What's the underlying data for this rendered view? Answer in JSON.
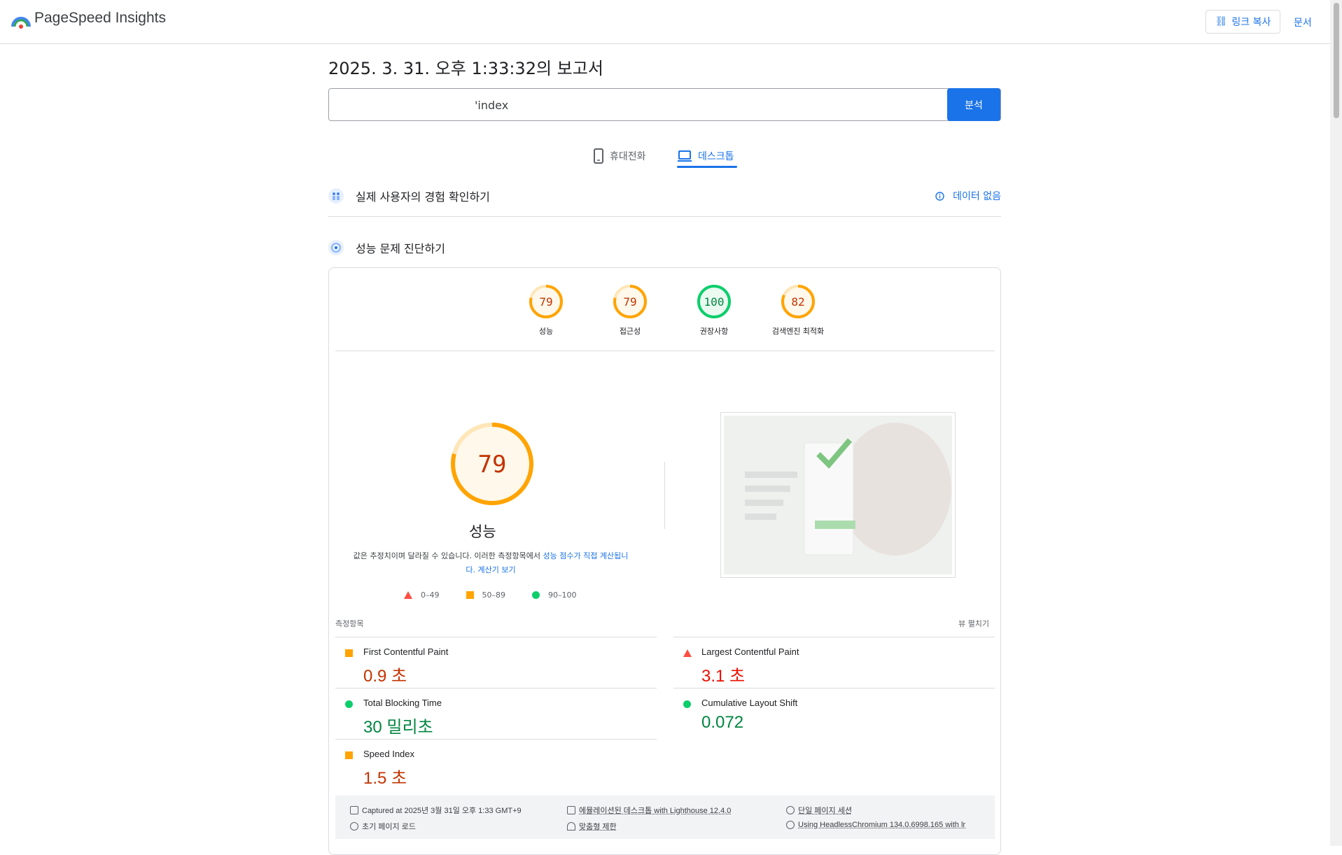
{
  "app": {
    "name": "PageSpeed Insights"
  },
  "header": {
    "copy_link_label": "링크 복사",
    "docs_label": "문서"
  },
  "report": {
    "title": "2025. 3. 31. 오후 1:33:32의 보고서",
    "url_value": "'index",
    "analyze_label": "분석"
  },
  "tabs": [
    {
      "label": "휴대전화",
      "active": false
    },
    {
      "label": "데스크톱",
      "active": true
    }
  ],
  "sections": {
    "real_users": {
      "title": "실제 사용자의 경험 확인하기",
      "status": "데이터 없음"
    },
    "diagnose": {
      "title": "성능 문제 진단하기"
    }
  },
  "scores": [
    {
      "label": "성능",
      "value": "79",
      "color": "#ffa400"
    },
    {
      "label": "접근성",
      "value": "79",
      "color": "#ffa400"
    },
    {
      "label": "권장사항",
      "value": "100",
      "color": "#0cce6b"
    },
    {
      "label": "검색엔진 최적화",
      "value": "82",
      "color": "#ffa400"
    }
  ],
  "performance": {
    "score": "79",
    "label": "성능",
    "note_plain": "값은 추정치이며 달라질 수 있습니다. 이러한 측정항목에서 ",
    "note_link": "성능 점수가 직접 계산됩니다.",
    "calc_link": "계산기 보기"
  },
  "legend": [
    {
      "range": "0–49",
      "shape": "triangle",
      "color": "#ff4e42"
    },
    {
      "range": "50–89",
      "shape": "square",
      "color": "#ffa400"
    },
    {
      "range": "90–100",
      "shape": "circle",
      "color": "#0cce6b"
    }
  ],
  "metrics": {
    "header": "측정항목",
    "expand": "뷰 펼치기",
    "items": [
      {
        "name": "First Contentful Paint",
        "value": "0.9 초",
        "status": "average",
        "color": "#c33300",
        "marker": "#ffa400"
      },
      {
        "name": "Largest Contentful Paint",
        "value": "3.1 초",
        "status": "fail",
        "color": "#eb0f00",
        "marker": "#ff4e42"
      },
      {
        "name": "Total Blocking Time",
        "value": "30 밀리초",
        "status": "pass",
        "color": "#018642",
        "marker": "#0cce6b"
      },
      {
        "name": "Cumulative Layout Shift",
        "value": "0.072",
        "status": "pass",
        "color": "#018642",
        "marker": "#0cce6b"
      },
      {
        "name": "Speed Index",
        "value": "1.5 초",
        "status": "average",
        "color": "#c33300",
        "marker": "#ffa400"
      }
    ]
  },
  "footer": {
    "captured": "Captured at 2025년 3월 31일 오후 1:33 GMT+9",
    "initial_load": "초기 페이지 로드",
    "emulated": "에뮬레이션된 데스크톱 with Lighthouse 12.4.0",
    "throttling": "맞춤형 제한",
    "session": "단일 페이지 세션",
    "browser": "Using HeadlessChromium 134.0.6998.165 with lr"
  },
  "icons": {
    "logo": "pagespeed-logo-icon",
    "copy": "link-icon",
    "mobile": "phone-icon",
    "desktop": "laptop-icon",
    "info": "info-icon"
  }
}
